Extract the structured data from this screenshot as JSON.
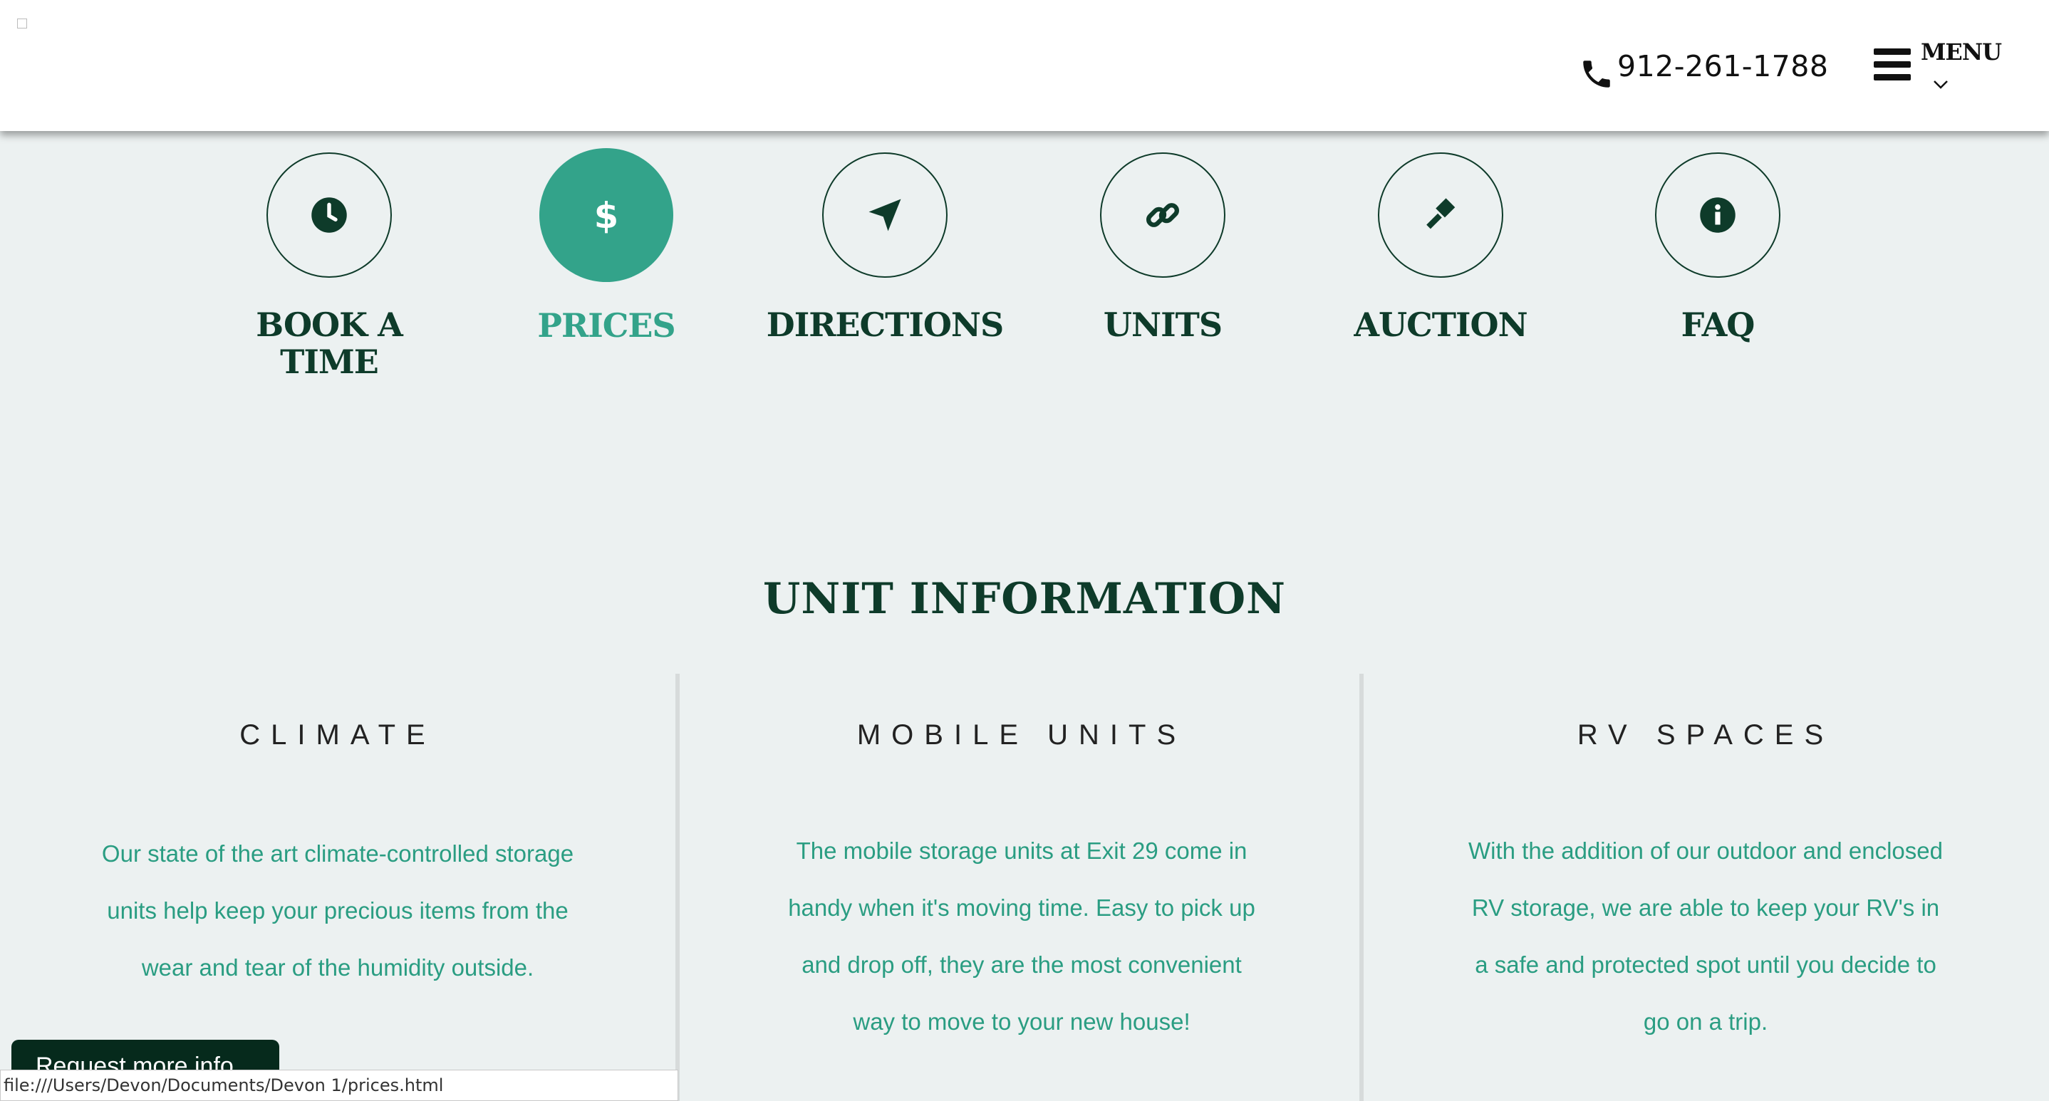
{
  "header": {
    "phone": "912-261-1788",
    "menu_label": "MENU"
  },
  "nav": {
    "items": [
      {
        "label": "BOOK A TIME",
        "icon": "clock-icon",
        "active": false
      },
      {
        "label": "PRICES",
        "icon": "dollar-icon",
        "active": true
      },
      {
        "label": "DIRECTIONS",
        "icon": "location-arrow-icon",
        "active": false
      },
      {
        "label": "UNITS",
        "icon": "link-icon",
        "active": false
      },
      {
        "label": "AUCTION",
        "icon": "gavel-icon",
        "active": false
      },
      {
        "label": "FAQ",
        "icon": "info-icon",
        "active": false
      }
    ]
  },
  "section": {
    "title": "UNIT INFORMATION"
  },
  "columns": [
    {
      "heading": "CLIMATE",
      "text": "Our state of the art climate-controlled storage units help keep your precious items from the wear and tear of the humidity outside."
    },
    {
      "heading": "MOBILE UNITS",
      "text": "The mobile storage units at Exit 29 come in handy when it's moving time. Easy to pick up and drop off, they are the most convenient way to move to your new house!"
    },
    {
      "heading": "RV SPACES",
      "text": "With the addition of our outdoor and enclosed RV storage, we are able to keep your RV's in a safe and protected spot until you decide to go on a trip."
    }
  ],
  "request_button": "Request more info",
  "status_bar": "file:///Users/Devon/Documents/Devon 1/prices.html",
  "colors": {
    "accent": "#33a38a",
    "dark_green": "#0e3b2a",
    "background": "#ecf1f1",
    "text_accent": "#2a9d82"
  }
}
